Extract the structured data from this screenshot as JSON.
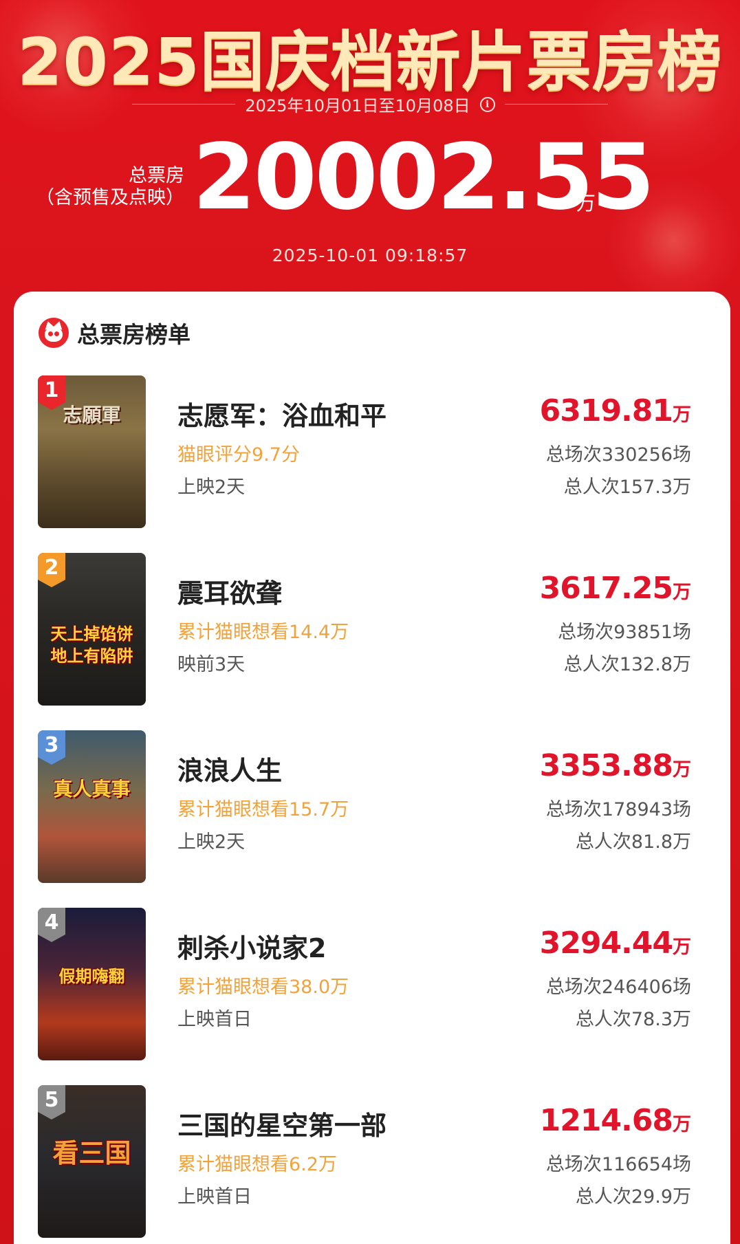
{
  "header": {
    "title": "2025国庆档新片票房榜",
    "date_range": "2025年10月01日至10月08日",
    "total_label_line1": "总票房",
    "total_label_line2": "（含预售及点映）",
    "total_value": "20002.55",
    "total_unit": "万",
    "timestamp": "2025-10-01  09:18:57"
  },
  "card": {
    "title": "总票房榜单"
  },
  "colors": {
    "header_red": "#e0131c",
    "box_office_red": "#e0142a",
    "score_orange": "#f2a23a",
    "rank_red": "#e8262b",
    "rank_orange": "#f39a2b",
    "rank_blue": "#5b8fd6",
    "rank_gray": "#8a8a8a"
  },
  "movies": [
    {
      "rank": "1",
      "name": "志愿军：浴血和平",
      "score": "猫眼评分9.7分",
      "days": "上映2天",
      "box_office": "6319.81",
      "unit": "万",
      "shows": "总场次330256场",
      "people": "总人次157.3万",
      "poster_text": "志願軍"
    },
    {
      "rank": "2",
      "name": "震耳欲聋",
      "score": "累计猫眼想看14.4万",
      "days": "映前3天",
      "box_office": "3617.25",
      "unit": "万",
      "shows": "总场次93851场",
      "people": "总人次132.8万",
      "poster_text": "天上掉馅饼 地上有陷阱"
    },
    {
      "rank": "3",
      "name": "浪浪人生",
      "score": "累计猫眼想看15.7万",
      "days": "上映2天",
      "box_office": "3353.88",
      "unit": "万",
      "shows": "总场次178943场",
      "people": "总人次81.8万",
      "poster_text": "真人真事"
    },
    {
      "rank": "4",
      "name": "刺杀小说家2",
      "score": "累计猫眼想看38.0万",
      "days": "上映首日",
      "box_office": "3294.44",
      "unit": "万",
      "shows": "总场次246406场",
      "people": "总人次78.3万",
      "poster_text": "假期嗨翻"
    },
    {
      "rank": "5",
      "name": "三国的星空第一部",
      "score": "累计猫眼想看6.2万",
      "days": "上映首日",
      "box_office": "1214.68",
      "unit": "万",
      "shows": "总场次116654场",
      "people": "总人次29.9万",
      "poster_text": "看三国"
    }
  ]
}
